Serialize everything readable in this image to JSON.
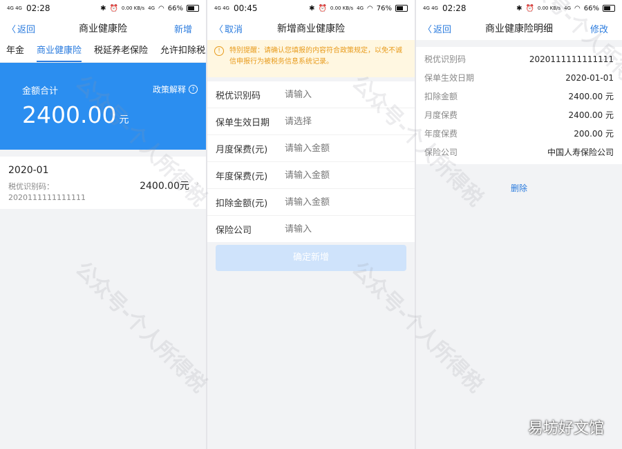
{
  "panel1": {
    "status": {
      "signal": "4G 4G",
      "time": "02:28",
      "net": "0.00 KB/s",
      "lte": "4G",
      "battery": "66%"
    },
    "nav": {
      "back": "返回",
      "title": "商业健康险",
      "action": "新增"
    },
    "tabs": [
      "年金",
      "商业健康险",
      "税延养老保险",
      "允许扣除税费"
    ],
    "banner": {
      "label": "金额合计",
      "policy": "政策解释",
      "amount": "2400.00",
      "unit": "元"
    },
    "record": {
      "month": "2020-01",
      "code_label": "税优识别码：",
      "code": "2020111111111111",
      "amount": "2400.00元"
    }
  },
  "panel2": {
    "status": {
      "signal": "4G 4G",
      "time": "00:45",
      "net": "0.00 KB/s",
      "lte": "4G",
      "battery": "76%"
    },
    "nav": {
      "back": "取消",
      "title": "新增商业健康险"
    },
    "notice": "特别提醒：请确认您填报的内容符合政策规定，以免不诚信申报行为被税务信息系统记录。",
    "fields": [
      {
        "label": "税优识别码",
        "placeholder": "请输入"
      },
      {
        "label": "保单生效日期",
        "placeholder": "请选择"
      },
      {
        "label": "月度保费(元)",
        "placeholder": "请输入金额"
      },
      {
        "label": "年度保费(元)",
        "placeholder": "请输入金额"
      },
      {
        "label": "扣除金额(元)",
        "placeholder": "请输入金额"
      },
      {
        "label": "保险公司",
        "placeholder": "请输入"
      }
    ],
    "submit": "确定新增"
  },
  "panel3": {
    "status": {
      "signal": "4G 4G",
      "time": "02:28",
      "net": "0.00 KB/s",
      "lte": "4G",
      "battery": "66%"
    },
    "nav": {
      "back": "返回",
      "title": "商业健康险明细",
      "action": "修改"
    },
    "rows": [
      {
        "label": "税优识别码",
        "value": "2020111111111111"
      },
      {
        "label": "保单生效日期",
        "value": "2020-01-01"
      },
      {
        "label": "扣除金额",
        "value": "2400.00 元"
      },
      {
        "label": "月度保费",
        "value": "2400.00 元"
      },
      {
        "label": "年度保费",
        "value": "200.00 元"
      },
      {
        "label": "保险公司",
        "value": "中国人寿保险公司"
      }
    ],
    "delete": "删除"
  },
  "watermark": "公众号-个人所得税",
  "corner_mark": "易坊好文馆",
  "colors": {
    "accent": "#2a7bde",
    "banner": "#2b8ef0",
    "notice_bg": "#fff7e1",
    "notice_text": "#e89b1c"
  }
}
